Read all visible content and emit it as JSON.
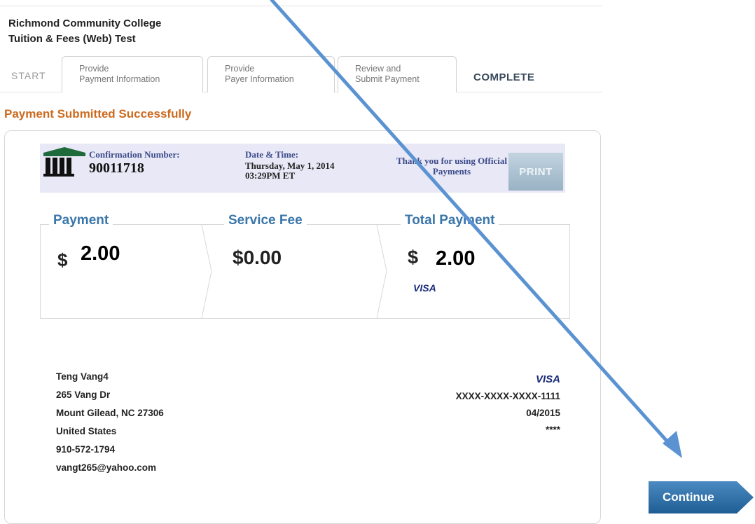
{
  "org": {
    "name": "Richmond Community College",
    "subtitle": "Tuition & Fees (Web) Test"
  },
  "steps": {
    "start": "START",
    "step1": [
      "Provide",
      "Payment Information"
    ],
    "step2": [
      "Provide",
      "Payer Information"
    ],
    "step3": [
      "Review and",
      "Submit Payment"
    ],
    "complete": "COMPLETE"
  },
  "status_message": "Payment Submitted Successfully",
  "confirmation": {
    "label": "Confirmation Number:",
    "number": "90011718",
    "datetime_label": "Date & Time:",
    "date": "Thursday, May 1, 2014",
    "time": "03:29PM ET",
    "thanks": "Thank you for using Official Payments",
    "print_label": "PRINT"
  },
  "amounts": {
    "payment_label": "Payment",
    "payment_symbol": "$",
    "payment_value": "2.00",
    "fee_label": "Service Fee",
    "fee_value": "$0.00",
    "total_label": "Total Payment",
    "total_symbol": "$",
    "total_value": "2.00",
    "card_brand": "VISA"
  },
  "payer": {
    "lines": [
      "Teng Vang4",
      "265 Vang Dr",
      "Mount Gilead, NC 27306",
      "United States",
      "910-572-1794",
      "vangt265@yahoo.com"
    ]
  },
  "card": {
    "brand": "VISA",
    "number": "XXXX-XXXX-XXXX-1111",
    "expiry": "04/2015",
    "cvv": "****"
  },
  "continue_label": "Continue",
  "colors": {
    "accent_orange": "#cc6a1e",
    "heading_blue": "#3b76aa",
    "arrow_blue": "#5b93d2",
    "confbar_bg": "#e8e8f6"
  }
}
